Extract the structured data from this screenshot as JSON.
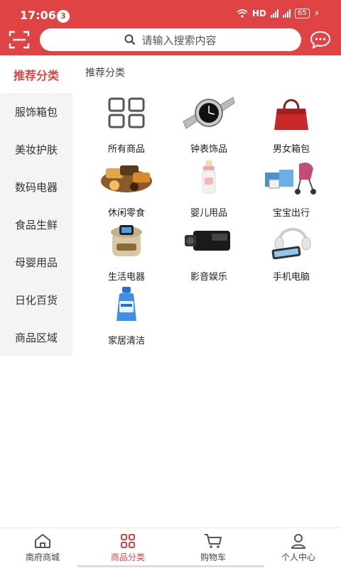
{
  "status_bar": {
    "time": "17:06",
    "notification_count": "3",
    "network_label": "HD",
    "battery": "65"
  },
  "header": {
    "search_placeholder": "请输入搜索内容",
    "accent_color": "#e04343"
  },
  "sidebar": {
    "items": [
      {
        "label": "推荐分类",
        "active": true
      },
      {
        "label": "服饰箱包"
      },
      {
        "label": "美妆护肤"
      },
      {
        "label": "数码电器"
      },
      {
        "label": "食品生鲜"
      },
      {
        "label": "母婴用品"
      },
      {
        "label": "日化百货"
      },
      {
        "label": "商品区域"
      }
    ]
  },
  "main": {
    "section_title": "推荐分类",
    "categories": [
      {
        "label": "所有商品",
        "icon": "grid-icon"
      },
      {
        "label": "钟表饰品",
        "icon": "watch-icon"
      },
      {
        "label": "男女箱包",
        "icon": "handbag-icon"
      },
      {
        "label": "休闲零食",
        "icon": "snacks-icon"
      },
      {
        "label": "婴儿用品",
        "icon": "baby-bottle-icon"
      },
      {
        "label": "宝宝出行",
        "icon": "stroller-icon"
      },
      {
        "label": "生活电器",
        "icon": "foot-spa-icon"
      },
      {
        "label": "影音娱乐",
        "icon": "camcorder-icon"
      },
      {
        "label": "手机电脑",
        "icon": "headphones-phone-icon"
      },
      {
        "label": "家居清洁",
        "icon": "detergent-bottle-icon"
      }
    ]
  },
  "bottom_nav": {
    "items": [
      {
        "label": "南府商城",
        "icon": "home-icon"
      },
      {
        "label": "商品分类",
        "icon": "category-icon",
        "active": true
      },
      {
        "label": "购物车",
        "icon": "cart-icon"
      },
      {
        "label": "个人中心",
        "icon": "user-icon"
      }
    ]
  }
}
